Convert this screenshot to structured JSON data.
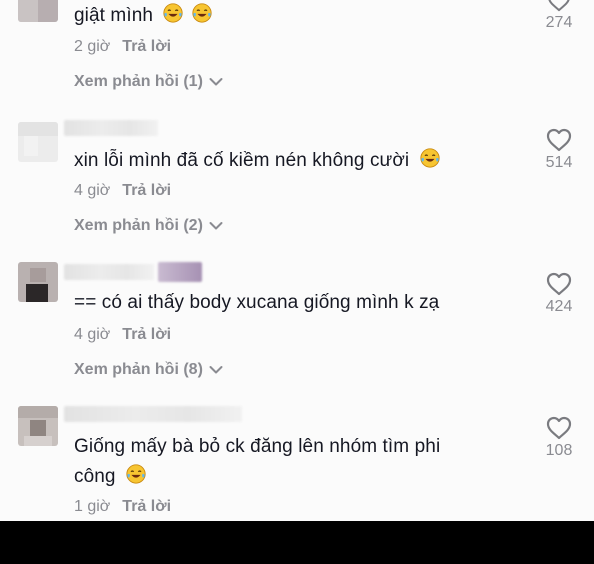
{
  "comments": [
    {
      "text": "giật mình",
      "emojis": [
        "laughing-tears",
        "laughing-tears"
      ],
      "time": "2 giờ",
      "reply_label": "Trả lời",
      "view_replies": "Xem phản hồi (1)",
      "likes": "274"
    },
    {
      "text": "xin lỗi mình đã cố kiềm nén không cười",
      "emojis": [
        "laughing-tears"
      ],
      "time": "4 giờ",
      "reply_label": "Trả lời",
      "view_replies": "Xem phản hồi (2)",
      "likes": "514"
    },
    {
      "text": "== có ai thấy body xucana giống mình k zạ",
      "emojis": [],
      "time": "4 giờ",
      "reply_label": "Trả lời",
      "view_replies": "Xem phản hồi (8)",
      "likes": "424"
    },
    {
      "text_line1": "Giống mấy bà bỏ ck đăng lên nhóm tìm phi",
      "text_line2": "công",
      "emojis": [
        "laughing-tears"
      ],
      "time": "1 giờ",
      "reply_label": "Trả lời",
      "likes": "108"
    }
  ],
  "colors": {
    "text": "#161823",
    "muted": "#8a8b91",
    "background": "#fbfbfb",
    "bottom_bar": "#000000"
  },
  "icons": [
    "heart-outline-icon",
    "chevron-down-icon",
    "laughing-tears-emoji"
  ]
}
